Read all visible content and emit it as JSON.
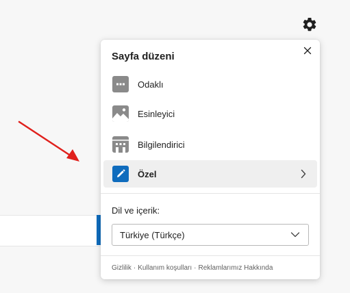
{
  "panel": {
    "title": "Sayfa düzeni",
    "layouts": [
      {
        "label": "Odaklı",
        "icon": "focused-layout-icon",
        "selected": false
      },
      {
        "label": "Esinleyici",
        "icon": "inspirational-layout-icon",
        "selected": false
      },
      {
        "label": "Bilgilendirici",
        "icon": "informational-layout-icon",
        "selected": false
      },
      {
        "label": "Özel",
        "icon": "custom-layout-pencil-icon",
        "selected": true
      }
    ],
    "language_label": "Dil ve içerik:",
    "language_value": "Türkiye (Türkçe)",
    "footer": {
      "privacy": "Gizlilik",
      "terms": "Kullanım koşulları",
      "ads": "Reklamlarımız Hakkında",
      "separator": "·"
    }
  },
  "colors": {
    "accent": "#0f6cbd",
    "arrow": "#e0201c",
    "icon_gray": "#8a8a8a"
  }
}
